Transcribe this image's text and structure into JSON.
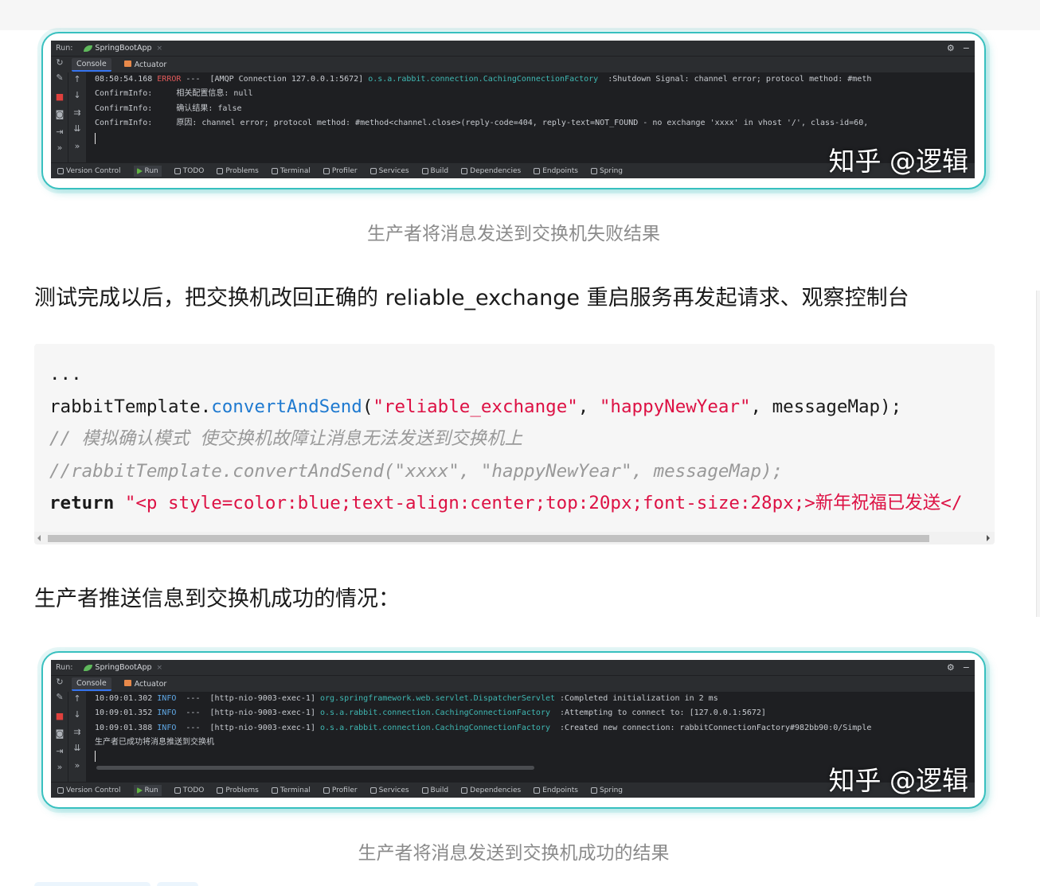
{
  "ide_common": {
    "run_label": "Run:",
    "app_tab": "SpringBootApp",
    "tab_close": "×",
    "subtabs": [
      "Console",
      "Actuator"
    ],
    "footer": [
      "Version Control",
      "Run",
      "TODO",
      "Problems",
      "Terminal",
      "Profiler",
      "Services",
      "Build",
      "Dependencies",
      "Endpoints",
      "Spring"
    ],
    "settings_icon": "⚙",
    "minimize_icon": "−",
    "watermark": "知乎 @逻辑"
  },
  "ide_fail": {
    "lines": [
      {
        "time": "08:50:54.168 ",
        "level": "ERROR",
        "mid": " ---  [AMQP Connection 127.0.0.1:5672] ",
        "cls": "o.s.a.rabbit.connection.CachingConnectionFactory",
        "msg": "  :Shutdown Signal: channel error; protocol method: #meth"
      },
      {
        "plain": "ConfirmInfo:     相关配置信息: null"
      },
      {
        "plain": "ConfirmInfo:     确认结果: false"
      },
      {
        "plain": "ConfirmInfo:     原因: channel error; protocol method: #method<channel.close>(reply-code=404, reply-text=NOT_FOUND - no exchange 'xxxx' in vhost '/', class-id=60,"
      }
    ]
  },
  "caption_fail": "生产者将消息发送到交换机失败结果",
  "para_after_test": "测试完成以后，把交换机改回正确的 reliable_exchange 重启服务再发起请求、观察控制台",
  "code": {
    "l1": "...",
    "l2_obj": "rabbitTemplate.",
    "l2_fn": "convertAndSend",
    "l2_open": "(",
    "l2_s1": "\"reliable_exchange\"",
    "l2_sep1": ", ",
    "l2_s2": "\"happyNewYear\"",
    "l2_rest": ", messageMap);",
    "l3": "// 模拟确认模式 使交换机故障让消息无法发送到交换机上",
    "l4": "//rabbitTemplate.convertAndSend(\"xxxx\", \"happyNewYear\", messageMap);",
    "l5_kw": "return",
    "l5_str": " \"<p style=color:blue;text-align:center;top:20px;font-size:28px;>新年祝福已发送</"
  },
  "para_success": "生产者推送信息到交换机成功的情况：",
  "ide_success": {
    "lines": [
      {
        "time": "10:09:01.302 ",
        "level": "INFO ",
        "mid": " ---  [http-nio-9003-exec-1] ",
        "cls": "org.springframework.web.servlet.DispatcherServlet",
        "msg": " :Completed initialization in 2 ms"
      },
      {
        "time": "10:09:01.352 ",
        "level": "INFO ",
        "mid": " ---  [http-nio-9003-exec-1] ",
        "cls": "o.s.a.rabbit.connection.CachingConnectionFactory ",
        "msg": " :Attempting to connect to: [127.0.0.1:5672]"
      },
      {
        "time": "10:09:01.388 ",
        "level": "INFO ",
        "mid": " ---  [http-nio-9003-exec-1] ",
        "cls": "o.s.a.rabbit.connection.CachingConnectionFactory ",
        "msg": " :Created new connection: rabbitConnectionFactory#982bb90:0/Simple"
      },
      {
        "plain": "生产者已成功将消息推送到交换机"
      }
    ]
  },
  "caption_success": "生产者将消息发送到交换机成功的结果",
  "colors": {
    "frame": "#38c0bf",
    "error": "#e05a5a",
    "info": "#5fa8e6",
    "class": "#3fb8b3",
    "string": "#dd1144",
    "function": "#1f7ad0"
  }
}
